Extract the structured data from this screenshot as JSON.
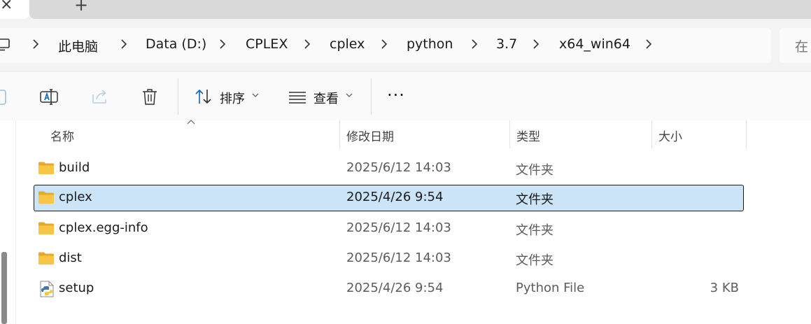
{
  "tabbar": {
    "close_glyph": "×",
    "new_tab_glyph": "+"
  },
  "breadcrumb": {
    "items": [
      "此电脑",
      "Data (D:)",
      "CPLEX",
      "cplex",
      "python",
      "3.7",
      "x64_win64"
    ]
  },
  "search": {
    "placeholder": "在"
  },
  "toolbar": {
    "sort_label": "排序",
    "view_label": "查看",
    "more_label": "···"
  },
  "columns": {
    "name": "名称",
    "date": "修改日期",
    "type": "类型",
    "size": "大小"
  },
  "files": [
    {
      "name": "build",
      "date": "2025/6/12 14:03",
      "type": "文件夹",
      "size": "",
      "icon": "folder-icon"
    },
    {
      "name": "cplex",
      "date": "2025/4/26 9:54",
      "type": "文件夹",
      "size": "",
      "icon": "folder-icon",
      "selected": true
    },
    {
      "name": "cplex.egg-info",
      "date": "2025/6/12 14:03",
      "type": "文件夹",
      "size": "",
      "icon": "folder-icon"
    },
    {
      "name": "dist",
      "date": "2025/6/12 14:03",
      "type": "文件夹",
      "size": "",
      "icon": "folder-icon"
    },
    {
      "name": "setup",
      "date": "2025/4/26 9:54",
      "type": "Python File",
      "size": "3 KB",
      "icon": "python-file-icon"
    }
  ],
  "colors": {
    "selection": "#cce4f7",
    "folder": "#f8c646",
    "accent": "#0a66c2"
  }
}
